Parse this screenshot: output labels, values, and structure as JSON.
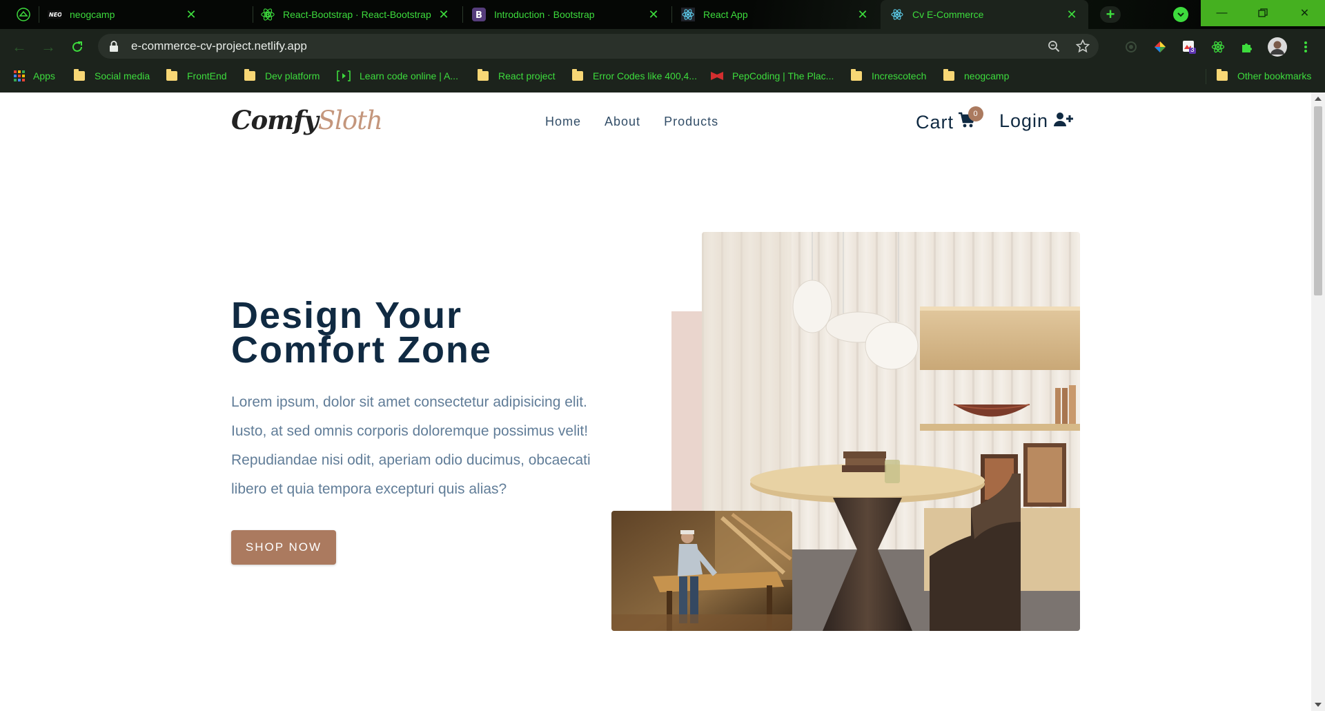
{
  "browser": {
    "tabs": [
      {
        "title": "neogcamp",
        "favicon": "neog-icon"
      },
      {
        "title": "React-Bootstrap · React-Bootstrap",
        "favicon": "react-icon"
      },
      {
        "title": "Introduction · Bootstrap",
        "favicon": "bootstrap-icon"
      },
      {
        "title": "React App",
        "favicon": "react-icon"
      },
      {
        "title": "Cv E-Commerce",
        "favicon": "react-icon",
        "active": true
      }
    ],
    "new_tab": "+",
    "url": "e-commerce-cv-project.netlify.app",
    "extension_badge": "3",
    "bookmarks": [
      {
        "label": "Apps",
        "icon": "apps-grid-icon"
      },
      {
        "label": "Social media",
        "icon": "folder-icon"
      },
      {
        "label": "FrontEnd",
        "icon": "folder-icon"
      },
      {
        "label": "Dev platform",
        "icon": "folder-icon"
      },
      {
        "label": "Learn code online | A...",
        "icon": "code-bracket-icon"
      },
      {
        "label": "React project",
        "icon": "folder-icon"
      },
      {
        "label": "Error Codes like 400,4...",
        "icon": "folder-icon"
      },
      {
        "label": "PepCoding | The Plac...",
        "icon": "pepcoding-icon"
      },
      {
        "label": "Increscotech",
        "icon": "folder-icon"
      },
      {
        "label": "neogcamp",
        "icon": "folder-icon"
      }
    ],
    "other_bookmarks": "Other bookmarks",
    "accent_color": "#3ddc3d"
  },
  "site": {
    "logo_part1": "Comfy",
    "logo_part2": "Sloth",
    "nav": [
      "Home",
      "About",
      "Products"
    ],
    "cart_label": "Cart",
    "cart_count": "0",
    "login_label": "Login",
    "hero": {
      "title_line1": "Design Your",
      "title_line2": "Comfort Zone",
      "text": "Lorem ipsum, dolor sit amet consectetur adipisicing elit. Iusto, at sed omnis corporis doloremque possimus velit! Repudiandae nisi odit, aperiam odio ducimus, obcaecati libero et quia tempora excepturi quis alias?",
      "button": "SHOP NOW"
    },
    "colors": {
      "primary": "#ab7a5f",
      "heading": "#102a42",
      "body_text": "#617d98",
      "accent_bg": "#ead5cd"
    }
  }
}
